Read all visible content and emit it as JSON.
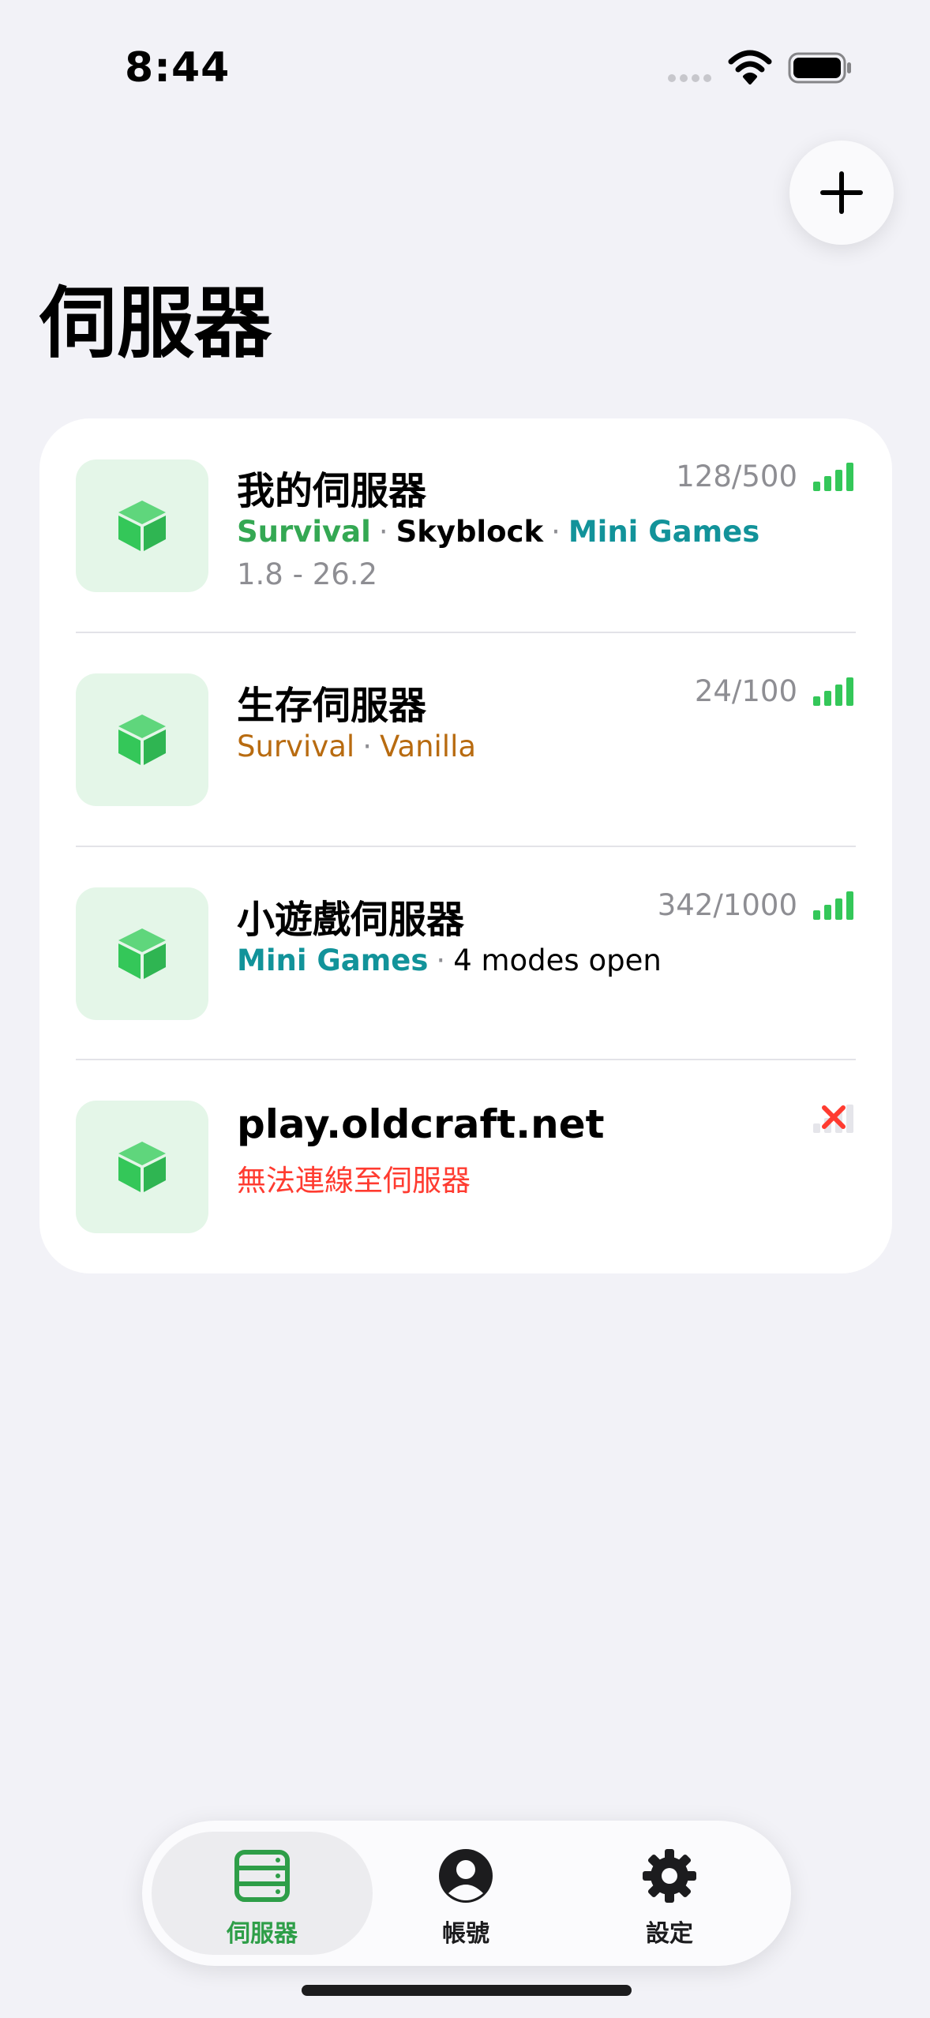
{
  "status_bar": {
    "time": "8:44"
  },
  "page": {
    "title": "伺服器"
  },
  "servers": [
    {
      "name": "我的伺服器",
      "players": "128/500",
      "tags": [
        {
          "text": "Survival",
          "color": "#34a853"
        },
        {
          "text": "Skyblock",
          "color": "#000000"
        },
        {
          "text": "Mini Games",
          "color": "#12939a"
        }
      ],
      "version": "1.8 - 26.2",
      "status": "online"
    },
    {
      "name": "生存伺服器",
      "players": "24/100",
      "tags": [
        {
          "text": "Survival",
          "color": "#b86b10"
        },
        {
          "text": "Vanilla",
          "color": "#b86b10"
        }
      ],
      "status": "online"
    },
    {
      "name": "小遊戲伺服器",
      "players": "342/1000",
      "tags": [
        {
          "text": "Mini Games",
          "color": "#12939a"
        },
        {
          "text": "4 modes open",
          "color": "#000000"
        }
      ],
      "status": "online"
    },
    {
      "name": "play.oldcraft.net",
      "error": "無法連線至伺服器",
      "status": "offline"
    }
  ],
  "tab_bar": {
    "tabs": [
      {
        "label": "伺服器",
        "icon": "server-icon",
        "active": true
      },
      {
        "label": "帳號",
        "icon": "account-icon",
        "active": false
      },
      {
        "label": "設定",
        "icon": "gear-icon",
        "active": false
      }
    ]
  },
  "colors": {
    "accent": "#34c759",
    "active_tab": "#2e9e48",
    "error": "#ff3b30",
    "background": "#f2f2f7"
  }
}
